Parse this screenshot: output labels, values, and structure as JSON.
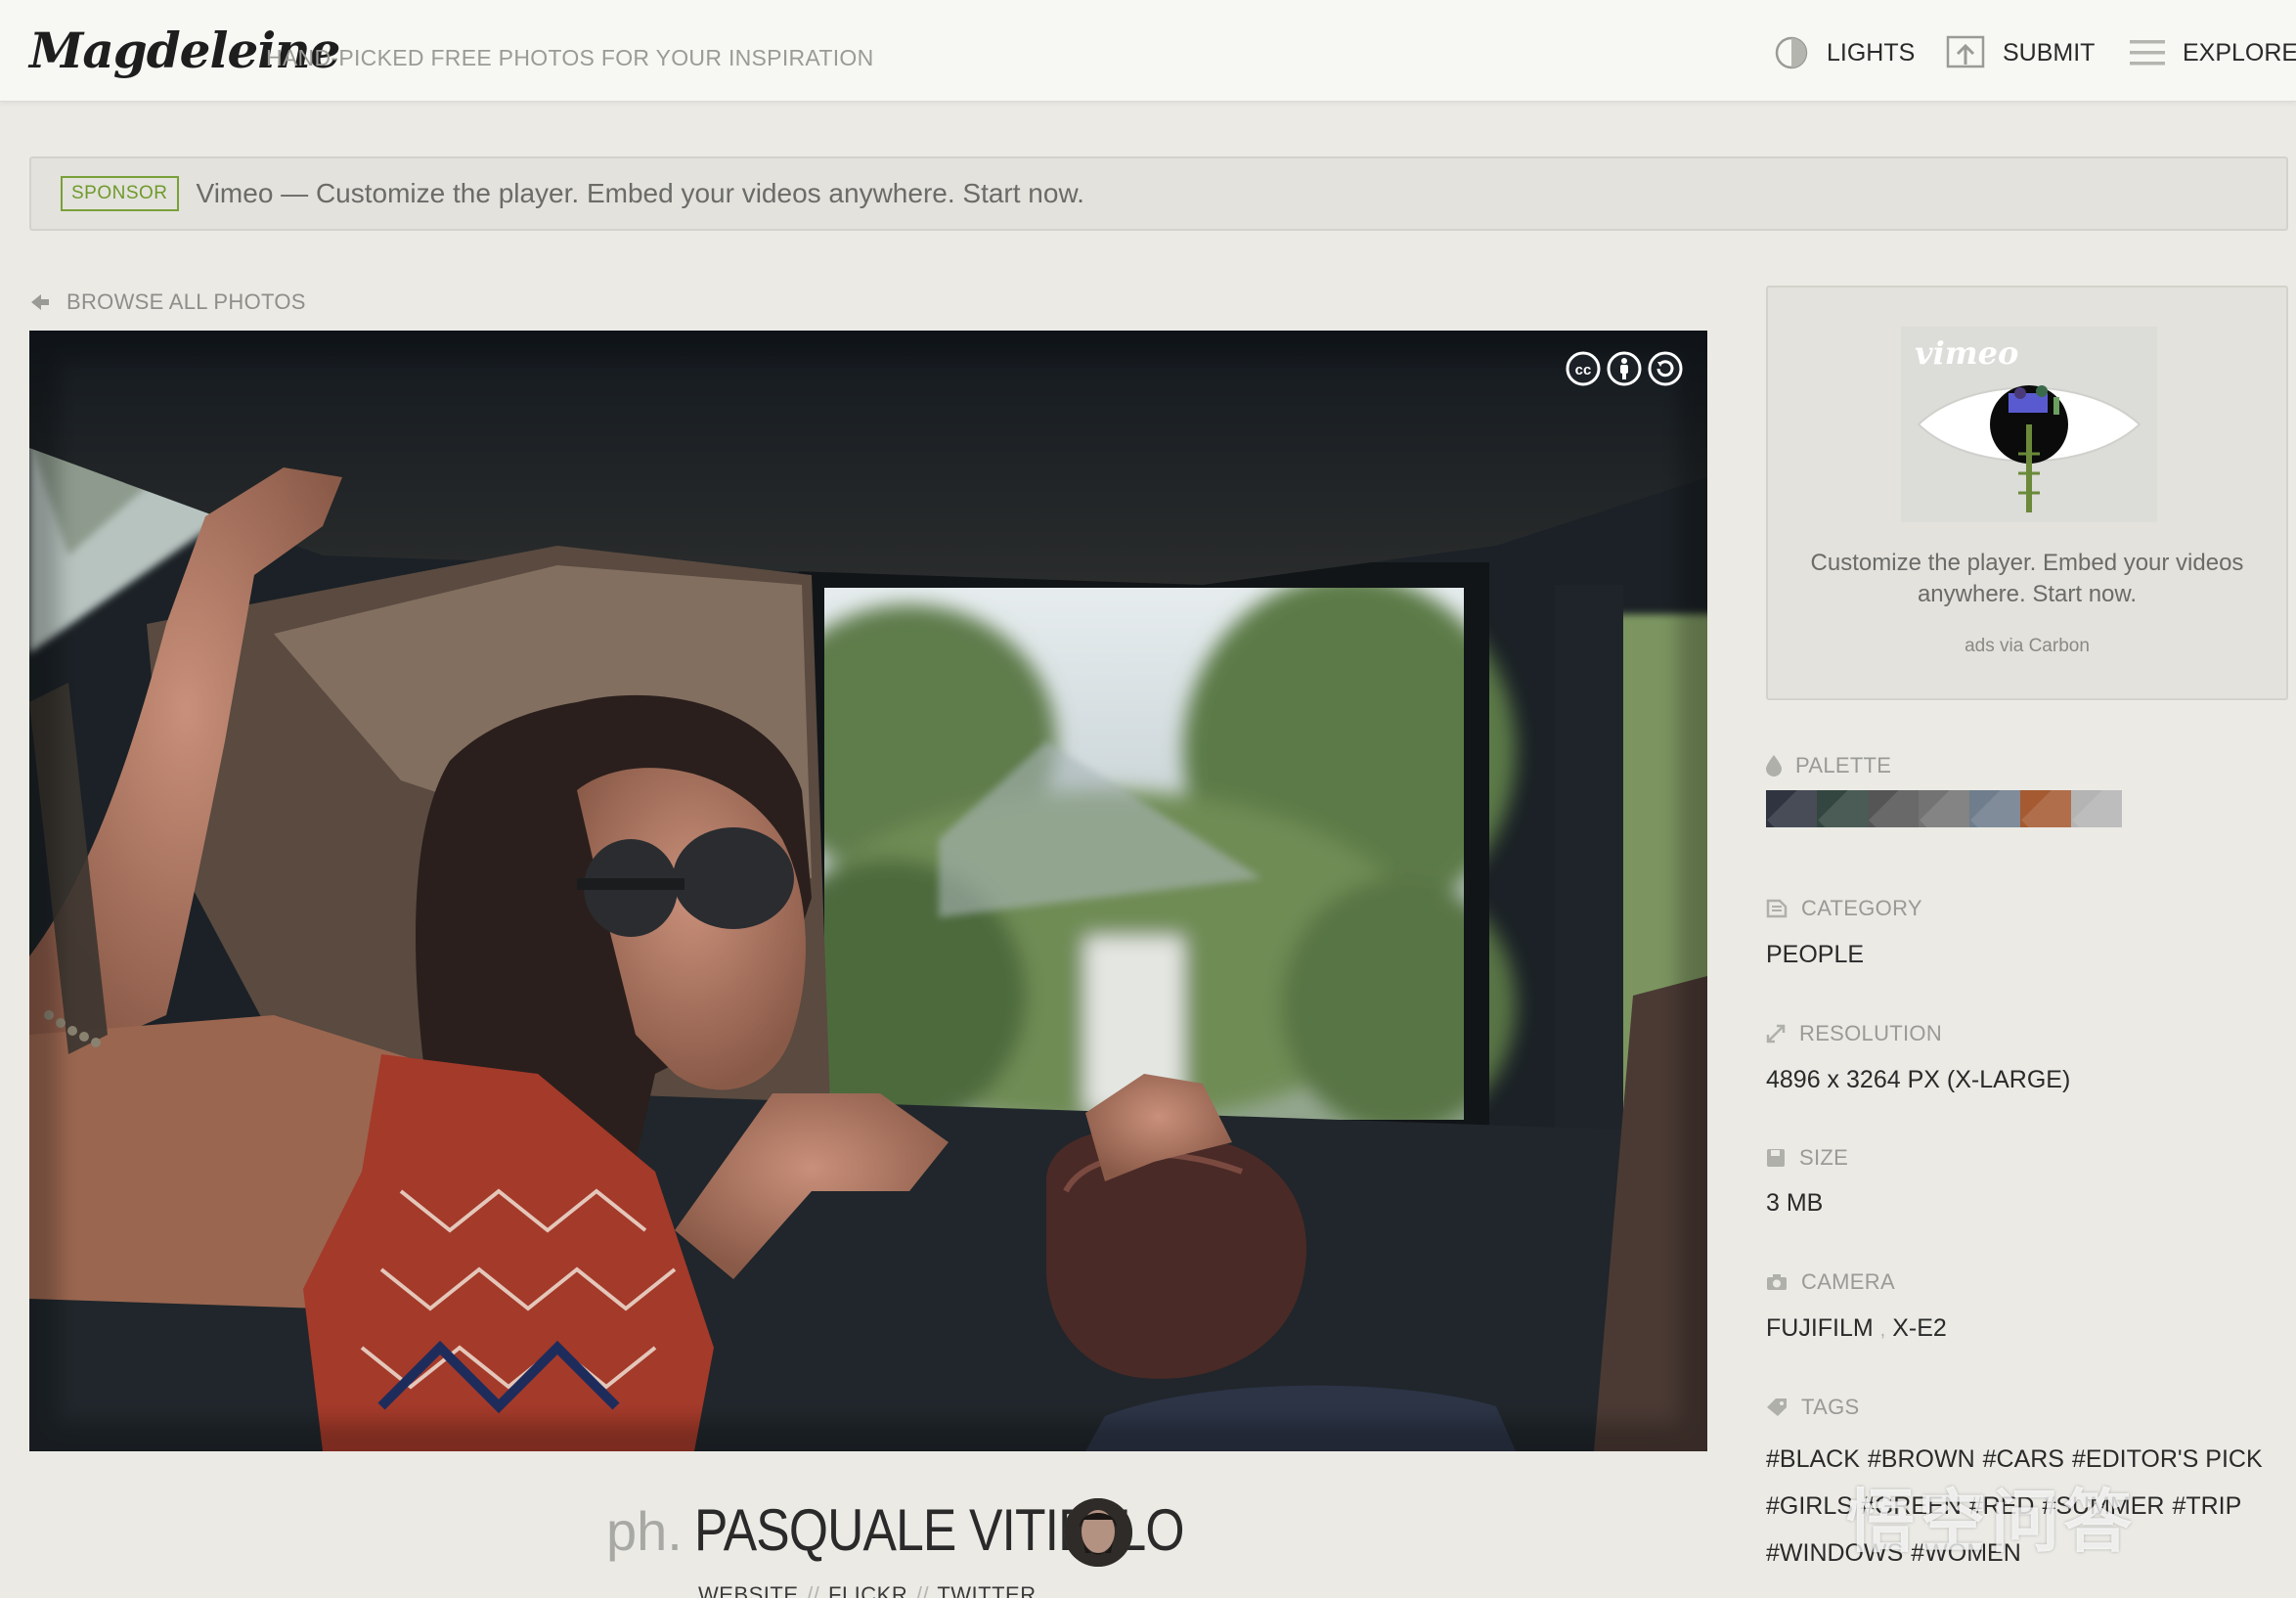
{
  "header": {
    "logo": "Magdeleine",
    "tagline": "HAND-PICKED FREE PHOTOS FOR YOUR INSPIRATION",
    "nav": {
      "lights": "LIGHTS",
      "submit": "SUBMIT",
      "explore": "EXPLORE"
    }
  },
  "sponsor": {
    "badge": "SPONSOR",
    "text": "Vimeo — Customize the player. Embed your videos anywhere. Start now."
  },
  "browse_label": "BROWSE ALL PHOTOS",
  "photographer": {
    "prefix": "ph.",
    "name": "PASQUALE VITIELLO",
    "links": [
      "WEBSITE",
      "FLICKR",
      "TWITTER"
    ],
    "separator": "//"
  },
  "ad": {
    "brand": "vimeo",
    "text": "Customize the player. Embed your videos anywhere. Start now.",
    "via": "ads via Carbon"
  },
  "details": {
    "palette_label": "PALETTE",
    "palette_colors": [
      "#2f3440",
      "#33463f",
      "#555556",
      "#737373",
      "#6f7d8c",
      "#a55a31",
      "#b4b4b4"
    ],
    "category_label": "CATEGORY",
    "category_value": "PEOPLE",
    "resolution_label": "RESOLUTION",
    "resolution_value": "4896 x 3264 PX (X-LARGE)",
    "size_label": "SIZE",
    "size_value": "3 MB",
    "camera_label": "CAMERA",
    "camera_make": "FUJIFILM",
    "camera_sep": ",",
    "camera_model": "X-E2",
    "tags_label": "TAGS",
    "tags": [
      "#BLACK",
      "#BROWN",
      "#CARS",
      "#EDITOR'S PICK",
      "#GIRLS",
      "#GREEN",
      "#RED",
      "#SUMMER",
      "#TRIP",
      "#WINDOWS",
      "#WOMEN"
    ]
  },
  "watermark": "悟空问答",
  "colors": {
    "sponsor_green": "#6f9a2c",
    "background": "#ebeae5"
  }
}
